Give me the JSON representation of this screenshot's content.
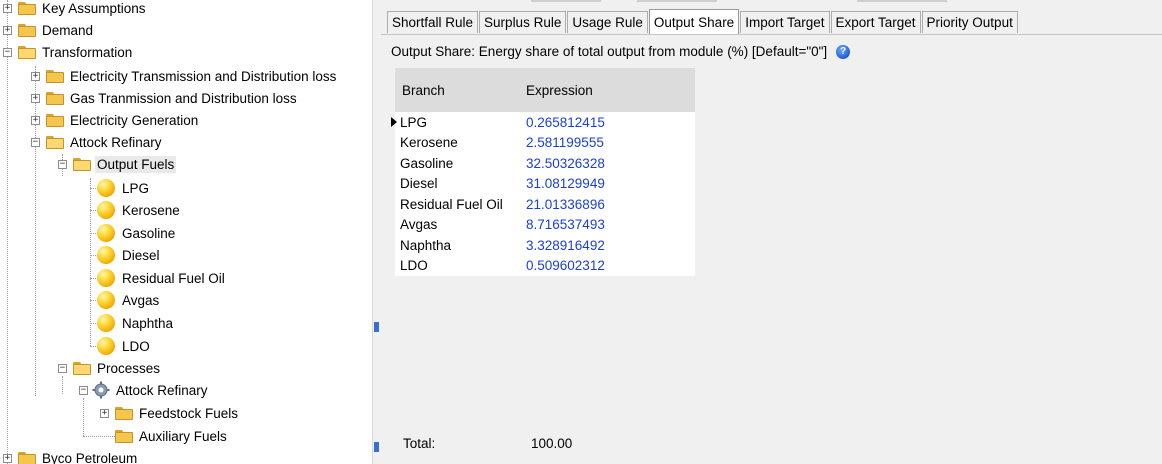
{
  "tree": {
    "nodes": [
      {
        "label": "Key Assumptions",
        "icon": "folder-icon",
        "expand": "plus"
      },
      {
        "label": "Demand",
        "icon": "folder-icon",
        "expand": "plus"
      },
      {
        "label": "Transformation",
        "icon": "folder-open-icon",
        "expand": "minus"
      },
      {
        "label": "Electricity Transmission and Distribution loss",
        "icon": "folder-icon",
        "expand": "plus"
      },
      {
        "label": "Gas Tranmission and Distribution loss",
        "icon": "folder-icon",
        "expand": "plus"
      },
      {
        "label": "Electricity Generation",
        "icon": "folder-icon",
        "expand": "plus"
      },
      {
        "label": "Attock Refinary",
        "icon": "folder-open-icon",
        "expand": "minus"
      },
      {
        "label": "Output Fuels",
        "icon": "folder-open-icon",
        "expand": "minus",
        "selected": true
      },
      {
        "label": "LPG",
        "icon": "fuel-ball-icon"
      },
      {
        "label": "Kerosene",
        "icon": "fuel-ball-icon"
      },
      {
        "label": "Gasoline",
        "icon": "fuel-ball-icon"
      },
      {
        "label": "Diesel",
        "icon": "fuel-ball-icon"
      },
      {
        "label": "Residual Fuel Oil",
        "icon": "fuel-ball-icon"
      },
      {
        "label": "Avgas",
        "icon": "fuel-ball-icon"
      },
      {
        "label": "Naphtha",
        "icon": "fuel-ball-icon"
      },
      {
        "label": "LDO",
        "icon": "fuel-ball-icon"
      },
      {
        "label": "Processes",
        "icon": "folder-open-icon",
        "expand": "minus"
      },
      {
        "label": "Attock Refinary",
        "icon": "process-gear-icon",
        "expand": "minus"
      },
      {
        "label": "Feedstock Fuels",
        "icon": "folder-icon",
        "expand": "plus"
      },
      {
        "label": "Auxiliary Fuels",
        "icon": "folder-icon"
      },
      {
        "label": "Byco Petroleum",
        "icon": "folder-icon",
        "expand": "plus"
      }
    ]
  },
  "tabs": [
    {
      "label": "Shortfall Rule"
    },
    {
      "label": "Surplus Rule"
    },
    {
      "label": "Usage Rule"
    },
    {
      "label": "Output Share",
      "active": true
    },
    {
      "label": "Import Target"
    },
    {
      "label": "Export Target"
    },
    {
      "label": "Priority Output"
    }
  ],
  "description": "Output Share: Energy share of total output from module (%) [Default=\"0\"]",
  "help_icon": "help-icon",
  "grid": {
    "columns": [
      "Branch",
      "Expression"
    ],
    "rows": [
      {
        "branch": "LPG",
        "expression": "0.265812415"
      },
      {
        "branch": "Kerosene",
        "expression": "2.581199555"
      },
      {
        "branch": "Gasoline",
        "expression": "32.50326328"
      },
      {
        "branch": "Diesel",
        "expression": "31.08129949"
      },
      {
        "branch": "Residual Fuel Oil",
        "expression": "21.01336896"
      },
      {
        "branch": "Avgas",
        "expression": "8.716537493"
      },
      {
        "branch": "Naphtha",
        "expression": "3.328916492"
      },
      {
        "branch": "LDO",
        "expression": "0.509602312"
      }
    ]
  },
  "total": {
    "label": "Total:",
    "value": "100.00"
  },
  "colors": {
    "expression_text": "#1a3fd8",
    "folder": "#f4c74c",
    "fuel_ball": "#ffd83a"
  }
}
